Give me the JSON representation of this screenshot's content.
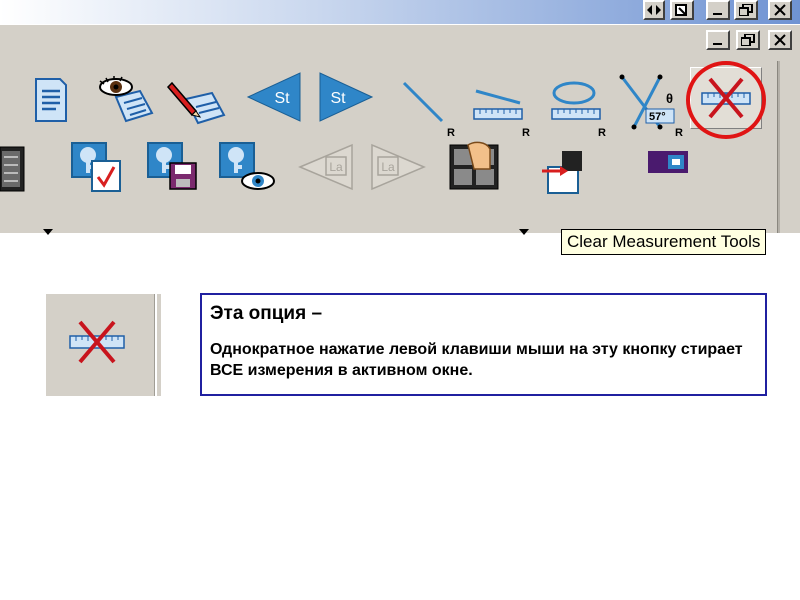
{
  "window": {
    "title_controls": [
      "resize",
      "restore",
      "minimize",
      "maximize",
      "close"
    ],
    "mdi_controls": [
      "minimize",
      "restore",
      "close"
    ]
  },
  "toolbar": {
    "row1": [
      {
        "name": "report-icon"
      },
      {
        "name": "view-annotations-icon"
      },
      {
        "name": "edit-annotations-icon"
      },
      {
        "name": "previous-study-icon",
        "label": "St"
      },
      {
        "name": "next-study-icon",
        "label": "St"
      },
      {
        "name": "line-measure-icon",
        "mark": "R"
      },
      {
        "name": "ruler-measure-icon",
        "mark": "R"
      },
      {
        "name": "ellipse-measure-icon",
        "mark": "R"
      },
      {
        "name": "angle-measure-icon",
        "mark": "R",
        "angle_text": "57°",
        "theta": "θ"
      },
      {
        "name": "clear-measurement-tools-icon"
      }
    ],
    "row2": [
      {
        "name": "layout-icon"
      },
      {
        "name": "key-check-icon"
      },
      {
        "name": "key-save-icon"
      },
      {
        "name": "key-view-icon"
      },
      {
        "name": "previous-layout-icon",
        "label": "La"
      },
      {
        "name": "next-layout-icon",
        "label": "La"
      },
      {
        "name": "hand-tool-icon"
      },
      {
        "name": "export-icon"
      },
      {
        "name": "purple-tool-icon"
      }
    ],
    "tooltip": "Clear Measurement Tools"
  },
  "description": {
    "title": "Эта опция –",
    "text": "Однократное нажатие левой клавиши мыши на эту кнопку  стирает ВСЕ измерения в активном окне."
  },
  "colors": {
    "toolbar_bg": "#d4d0c8",
    "highlight_circle": "#e01414",
    "box_border": "#2020a0",
    "tooltip_bg": "#ffffe1"
  }
}
